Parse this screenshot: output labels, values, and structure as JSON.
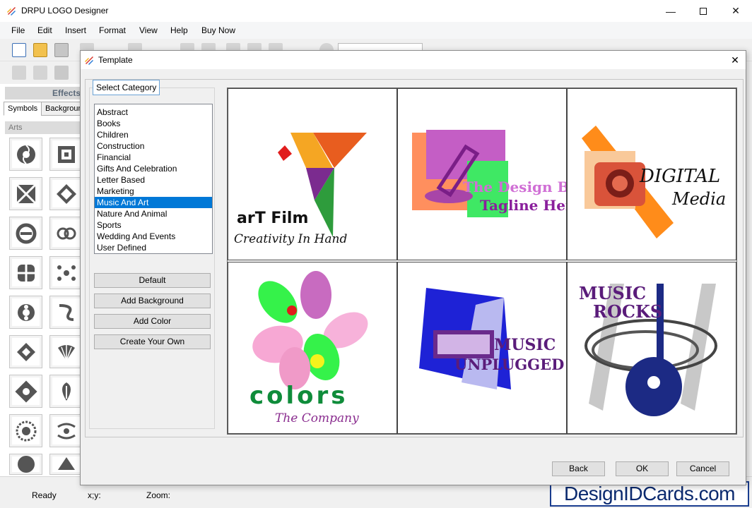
{
  "app": {
    "title": "DRPU LOGO Designer"
  },
  "menu": [
    "File",
    "Edit",
    "Insert",
    "Format",
    "View",
    "Help",
    "Buy Now"
  ],
  "effects_panel": {
    "header": "Effects",
    "tabs": [
      "Symbols",
      "Backgroun"
    ],
    "section": "Arts"
  },
  "dialog": {
    "title": "Template",
    "category_label": "Select Category",
    "categories": [
      "Abstract",
      "Books",
      "Children",
      "Construction",
      "Financial",
      "Gifts And Celebration",
      "Letter Based",
      "Marketing",
      "Music And Art",
      "Nature And Animal",
      "Sports",
      "Wedding And Events",
      "User Defined"
    ],
    "selected_category": "Music And Art",
    "side_buttons": [
      "Default",
      "Add Background",
      "Add Color",
      "Create Your Own"
    ],
    "templates": [
      {
        "line1": "arT Film",
        "line2": "Creativity In Hand"
      },
      {
        "line1": "The Design Bag",
        "line2": "Tagline Here"
      },
      {
        "line1": "DIGITAL",
        "line2": "Media"
      },
      {
        "line1": "colors",
        "line2": "The Company"
      },
      {
        "line1": "MUSIC",
        "line2": "UNPLUGGED"
      },
      {
        "line1": "MUSIC",
        "line2": "ROCKS"
      }
    ],
    "buttons": {
      "back": "Back",
      "ok": "OK",
      "cancel": "Cancel"
    }
  },
  "status": {
    "ready": "Ready",
    "coords": "x;y:",
    "zoom": "Zoom:"
  },
  "watermark": "DesignIDCards.com",
  "colors": {
    "selection": "#0078d7",
    "watermark_border": "#1a3d8f"
  }
}
